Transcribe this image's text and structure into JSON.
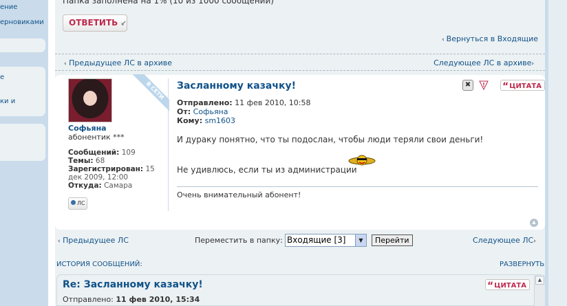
{
  "sidebar": {
    "items": [
      {
        "label": "ение"
      },
      {
        "label": "ерновиками"
      },
      {
        "label": "е"
      },
      {
        "label": "ки и"
      }
    ]
  },
  "folder_status": "Папка заполнена на 1% (10 из 1000 сообщений)",
  "reply_button": "ОТВЕТИТЬ",
  "return_link": "Вернуться в Входящие",
  "archive_nav": {
    "prev": "Предыдущее ЛС в архиве",
    "next": "Следующее ЛС в архиве"
  },
  "author": {
    "online_badge": "В СЕТИ",
    "name": "Софьяна",
    "rank": "абонентик ***",
    "posts_label": "Сообщений:",
    "posts_value": "109",
    "topics_label": "Темы:",
    "topics_value": "68",
    "registered_label": "Зарегистрирован:",
    "registered_value": "15 дек 2009, 12:00",
    "location_label": "Откуда:",
    "location_value": "Самара",
    "pm_button": "ЛС"
  },
  "message": {
    "title": "Засланному казачку!",
    "sent_label": "Отправлено:",
    "sent_value": "11 фев 2010, 10:58",
    "from_label": "От:",
    "from_value": "Софьяна",
    "to_label": "Кому:",
    "to_value": "sm1603",
    "line1": "И дураку понятно, что ты подослан, чтобы люди теряли свои деньги!",
    "line2": "Не удивлюсь, если ты из администрации",
    "signature": "Очень внимательный абонент!",
    "quote_button": "ЦИТАТА",
    "delete_icon": "✖",
    "report_icon": "!"
  },
  "bottom_nav": {
    "prev": "Предыдущее ЛС",
    "next": "Следующее ЛС",
    "move_label": "Переместить в папку:",
    "folder_selected": "Входящие [3]",
    "go_button": "Перейти"
  },
  "history": {
    "label": "ИСТОРИЯ СООБЩЕНИЙ:",
    "expand": "РАЗВЕРНУТЬ",
    "item_title": "Re: Засланному казачку!",
    "item_sent_label": "Отправлено:",
    "item_sent_value": "11 фев 2010, 15:34",
    "item_quote": "ЦИТАТА"
  },
  "colors": {
    "link": "#105289",
    "accent_red": "#bc2a4d",
    "panel_bg": "#ecf1f3",
    "frame_bg": "#cadceb"
  }
}
